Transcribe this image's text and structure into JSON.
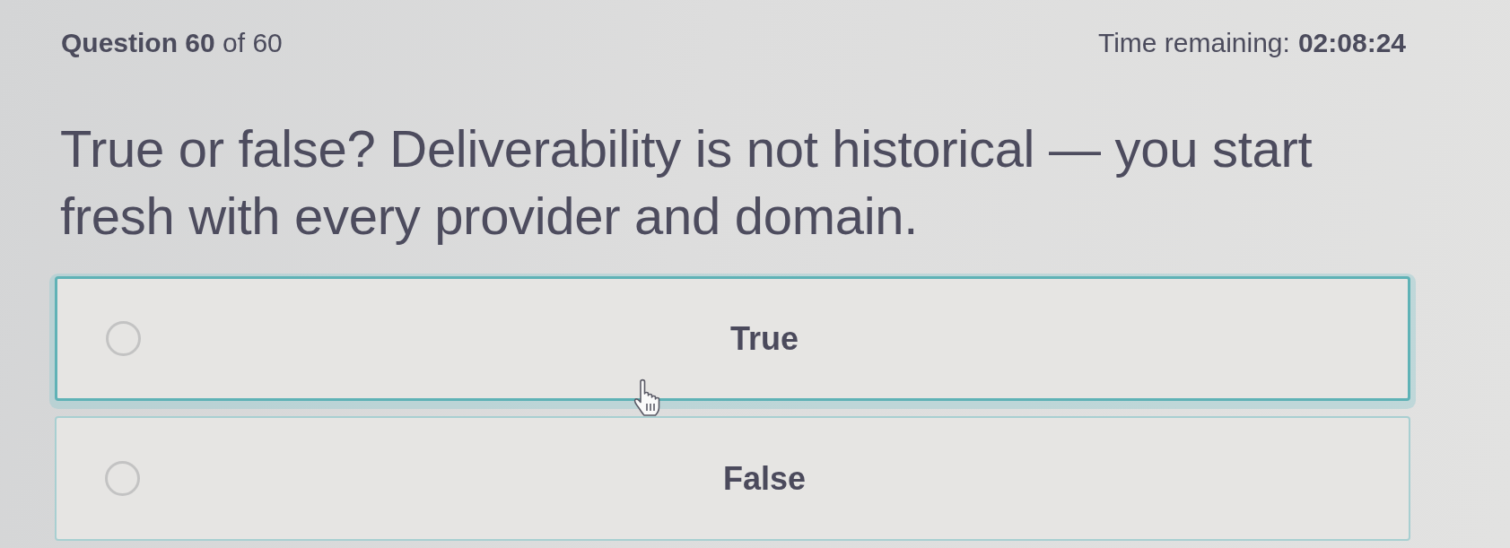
{
  "header": {
    "question_counter": "**Question 60** of 60",
    "timer": {
      "label": "Time remaining:",
      "value": "02:08:24"
    }
  },
  "question": {
    "text": "True or false? Deliverability is not historical — you start fresh with every provider and domain."
  },
  "options": [
    {
      "label": "True",
      "selected": false,
      "hovered": true
    },
    {
      "label": "False",
      "selected": false,
      "hovered": false
    }
  ]
}
